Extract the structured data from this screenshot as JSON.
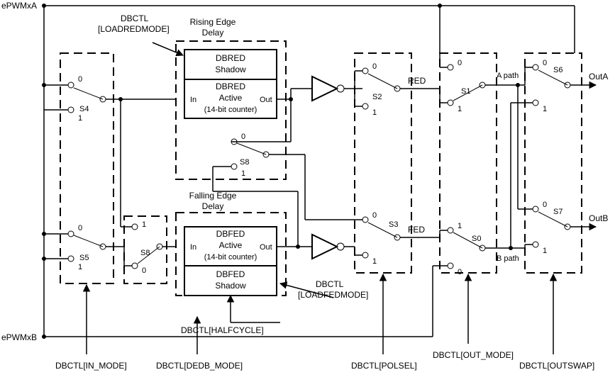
{
  "inputs": {
    "a": "ePWMxA",
    "b": "ePWMxB"
  },
  "outputs": {
    "a": "OutA",
    "b": "OutB"
  },
  "paths": {
    "a": "A path",
    "b": "B path"
  },
  "signals": {
    "red": "RED",
    "fed": "FED"
  },
  "switches": {
    "s0": "S0",
    "s1": "S1",
    "s2": "S2",
    "s3": "S3",
    "s4": "S4",
    "s5": "S5",
    "s6": "S6",
    "s7": "S7",
    "s8a": "S8",
    "s8b": "S8"
  },
  "dbctl": {
    "loadred": "DBCTL\n[LOADREDMODE]",
    "loadfed": "DBCTL\n[LOADFEDMODE]",
    "halfcycle": "DBCTL[HALFCYCLE]",
    "in_mode": "DBCTL[IN_MODE]",
    "dedb_mode": "DBCTL[DEDB_MODE]",
    "polsel": "DBCTL[POLSEL]",
    "out_mode": "DBCTL[OUT_MODE]",
    "outswap": "DBCTL[OUTSWAP]"
  },
  "rising": {
    "title": "Rising Edge\nDelay",
    "shadow": "DBRED\nShadow",
    "active_top": "DBRED",
    "active_mid": "Active",
    "active_bot": "(14-bit counter)",
    "in": "In",
    "out": "Out"
  },
  "falling": {
    "title": "Falling Edge\nDelay",
    "shadow": "DBFED\nShadow",
    "active_top": "DBFED",
    "active_mid": "Active",
    "active_bot": "(14-bit counter)",
    "in": "In",
    "out": "Out"
  },
  "mux": {
    "zero": "0",
    "one": "1"
  }
}
